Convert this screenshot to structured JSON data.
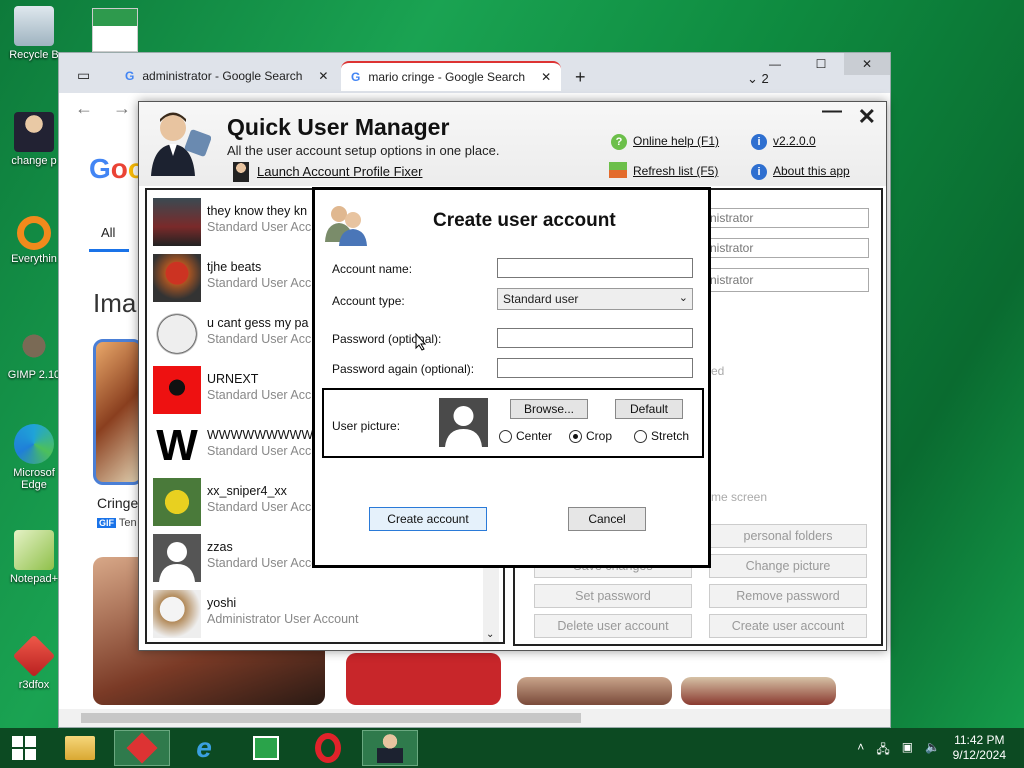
{
  "desktop": {
    "icons": [
      {
        "label": "Recycle B",
        "icon": "recycle-bin-icon"
      },
      {
        "label": "change p",
        "icon": "user-manager-icon"
      },
      {
        "label": "Everythin",
        "icon": "everything-search-icon"
      },
      {
        "label": "GIMP 2.10",
        "icon": "gimp-icon"
      },
      {
        "label": "Microsof Edge",
        "icon": "edge-icon"
      },
      {
        "label": "Notepad+",
        "icon": "notepad-icon"
      },
      {
        "label": "r3dfox",
        "icon": "r3dfox-icon"
      }
    ]
  },
  "browser": {
    "tabs": [
      {
        "label": "administrator - Google Search"
      },
      {
        "label": "mario cringe - Google Search"
      }
    ],
    "new_tab": "+",
    "tab_count": "2",
    "google_tab_all": "All",
    "images_heading": "Ima",
    "result_title": "Cringe",
    "result_source": "Ten",
    "gif_badge": "GIF"
  },
  "qum": {
    "title": "Quick User Manager",
    "subtitle": "All the user account setup options in one place.",
    "launch_link": "Launch Account Profile Fixer",
    "online_help": "Online help (F1)",
    "version": "v2.2.0.0",
    "refresh": "Refresh list (F5)",
    "about": "About this app",
    "users": [
      {
        "name": "they know they kn",
        "type": "Standard User Acc"
      },
      {
        "name": "tjhe beats",
        "type": "Standard User Acc"
      },
      {
        "name": "u cant gess my pa",
        "type": "Standard User Acc"
      },
      {
        "name": "URNEXT",
        "type": "Standard User Acc"
      },
      {
        "name": "WWWWWWWWWW",
        "type": "Standard User Acc"
      },
      {
        "name": "xx_sniper4_xx",
        "type": "Standard User Acc"
      },
      {
        "name": "zzas",
        "type": "Standard User Account"
      },
      {
        "name": "yoshi",
        "type": "Administrator User Account"
      }
    ],
    "right": {
      "field1": "nistrator",
      "field2": "nistrator",
      "field3": "nistrator",
      "faint1": "ed",
      "faint2": "me screen",
      "personal_folders": "personal folders",
      "save_changes": "Save changes",
      "change_picture": "Change picture",
      "set_password": "Set password",
      "remove_password": "Remove password",
      "delete_account": "Delete user account",
      "create_account": "Create user account"
    }
  },
  "dialog": {
    "title": "Create user account",
    "account_name_label": "Account name:",
    "account_name_value": "",
    "account_type_label": "Account type:",
    "account_type_value": "Standard user",
    "password_label": "Password (optional):",
    "password_again_label": "Password again (optional):",
    "user_picture_label": "User picture:",
    "browse": "Browse...",
    "default": "Default",
    "radio_center": "Center",
    "radio_crop": "Crop",
    "radio_stretch": "Stretch",
    "create_btn": "Create account",
    "cancel_btn": "Cancel"
  },
  "taskbar": {
    "time": "11:42 PM",
    "date": "9/12/2024"
  }
}
